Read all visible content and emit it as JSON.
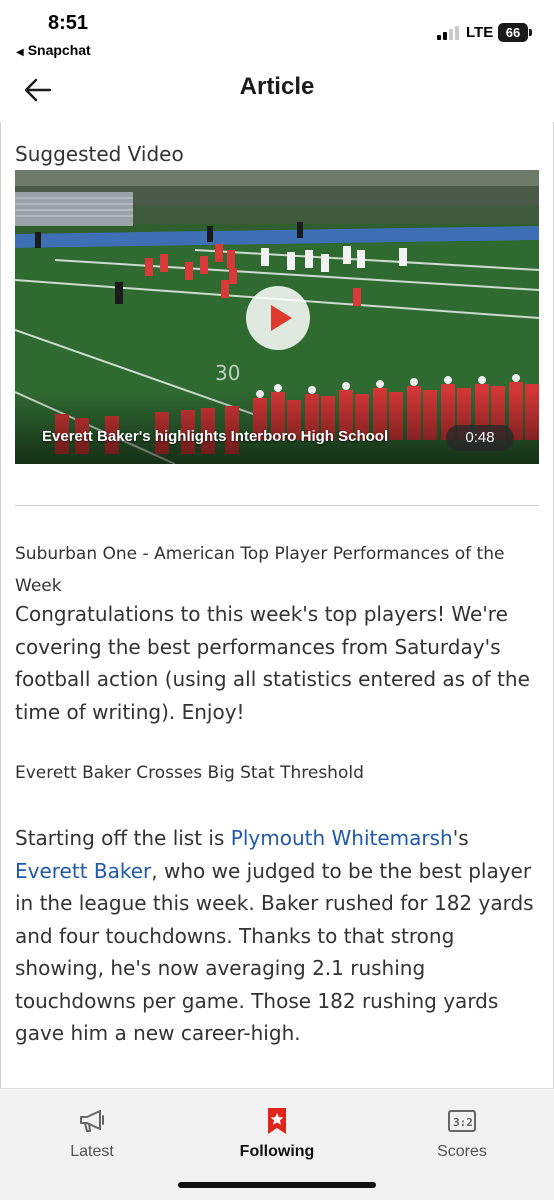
{
  "status_bar": {
    "time": "8:51",
    "back_app": "Snapchat",
    "network": "LTE",
    "battery": "66"
  },
  "nav": {
    "title": "Article",
    "back_icon": "arrow-left-icon"
  },
  "video": {
    "section_label": "Suggested Video",
    "caption": "Everett Baker's highlights Interboro High School",
    "duration": "0:48",
    "play_icon": "play-icon"
  },
  "article": {
    "meta_title": "Suburban One - American Top Player Performances of the Week",
    "intro": "Congratulations to this week's top players! We're covering the best performances from Saturday's football action (using all statistics entered as of the time of writing). Enjoy!",
    "sub_title": "Everett Baker Crosses Big Stat Threshold",
    "body": {
      "part1": "Starting off the list is ",
      "link_team": "Plymouth Whitemarsh",
      "part2": "'s ",
      "link_player": "Everett Baker",
      "part3": ", who we judged to be the best player in the league this week. Baker rushed for 182 yards and four touchdowns. Thanks to that strong showing, he's now averaging 2.1 rushing touchdowns per game. Those 182 rushing yards gave him a new career-high."
    }
  },
  "tabbar": {
    "tabs": [
      {
        "label": "Latest",
        "icon": "megaphone-icon",
        "active": false
      },
      {
        "label": "Following",
        "icon": "star-bookmark-icon",
        "active": true
      },
      {
        "label": "Scores",
        "icon": "scoreboard-icon",
        "active": false
      }
    ]
  },
  "colors": {
    "link": "#1e5aa8",
    "accent": "#e0261b",
    "play": "#e03a2c"
  }
}
